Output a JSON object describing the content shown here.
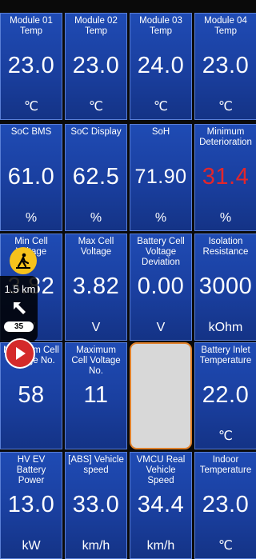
{
  "tiles": [
    {
      "label": "Module 01 Temp",
      "value": "23.0",
      "unit": "℃"
    },
    {
      "label": "Module 02 Temp",
      "value": "23.0",
      "unit": "℃"
    },
    {
      "label": "Module 03 Temp",
      "value": "24.0",
      "unit": "℃"
    },
    {
      "label": "Module 04 Temp",
      "value": "23.0",
      "unit": "℃"
    },
    {
      "label": "SoC BMS",
      "value": "61.0",
      "unit": "%"
    },
    {
      "label": "SoC Display",
      "value": "62.5",
      "unit": "%"
    },
    {
      "label": "SoH",
      "value": "71.90",
      "unit": "%"
    },
    {
      "label": "Minimum Deterioration",
      "value": "31.4",
      "unit": "%"
    },
    {
      "label": "Min Cell Voltage",
      "value": "3.82",
      "unit": "V"
    },
    {
      "label": "Max Cell Voltage",
      "value": "3.82",
      "unit": "V"
    },
    {
      "label": "Battery Cell Voltage Deviation",
      "value": "0.00",
      "unit": "V"
    },
    {
      "label": "Isolation Resistance",
      "value": "3000",
      "unit": "kOhm"
    },
    {
      "label": "Minimum Cell Voltage No.",
      "value": "58",
      "unit": ""
    },
    {
      "label": "Maximum Cell Voltage No.",
      "value": "11",
      "unit": ""
    },
    {
      "label": "",
      "value": "",
      "unit": ""
    },
    {
      "label": "Battery Inlet Temperature",
      "value": "22.0",
      "unit": "℃"
    },
    {
      "label": "HV EV Battery Power",
      "value": "13.0",
      "unit": "kW"
    },
    {
      "label": "[ABS] Vehicle speed",
      "value": "33.0",
      "unit": "km/h"
    },
    {
      "label": "VMCU Real Vehicle Speed",
      "value": "34.4",
      "unit": "km/h"
    },
    {
      "label": "Indoor Temperature",
      "value": "23.0",
      "unit": "℃"
    }
  ],
  "nav": {
    "distance": "1.5 km",
    "speed_limit": "35",
    "warning_color": "#e3262b",
    "icons": [
      "road-works-icon",
      "turn-arrow-icon",
      "play-icon"
    ]
  }
}
